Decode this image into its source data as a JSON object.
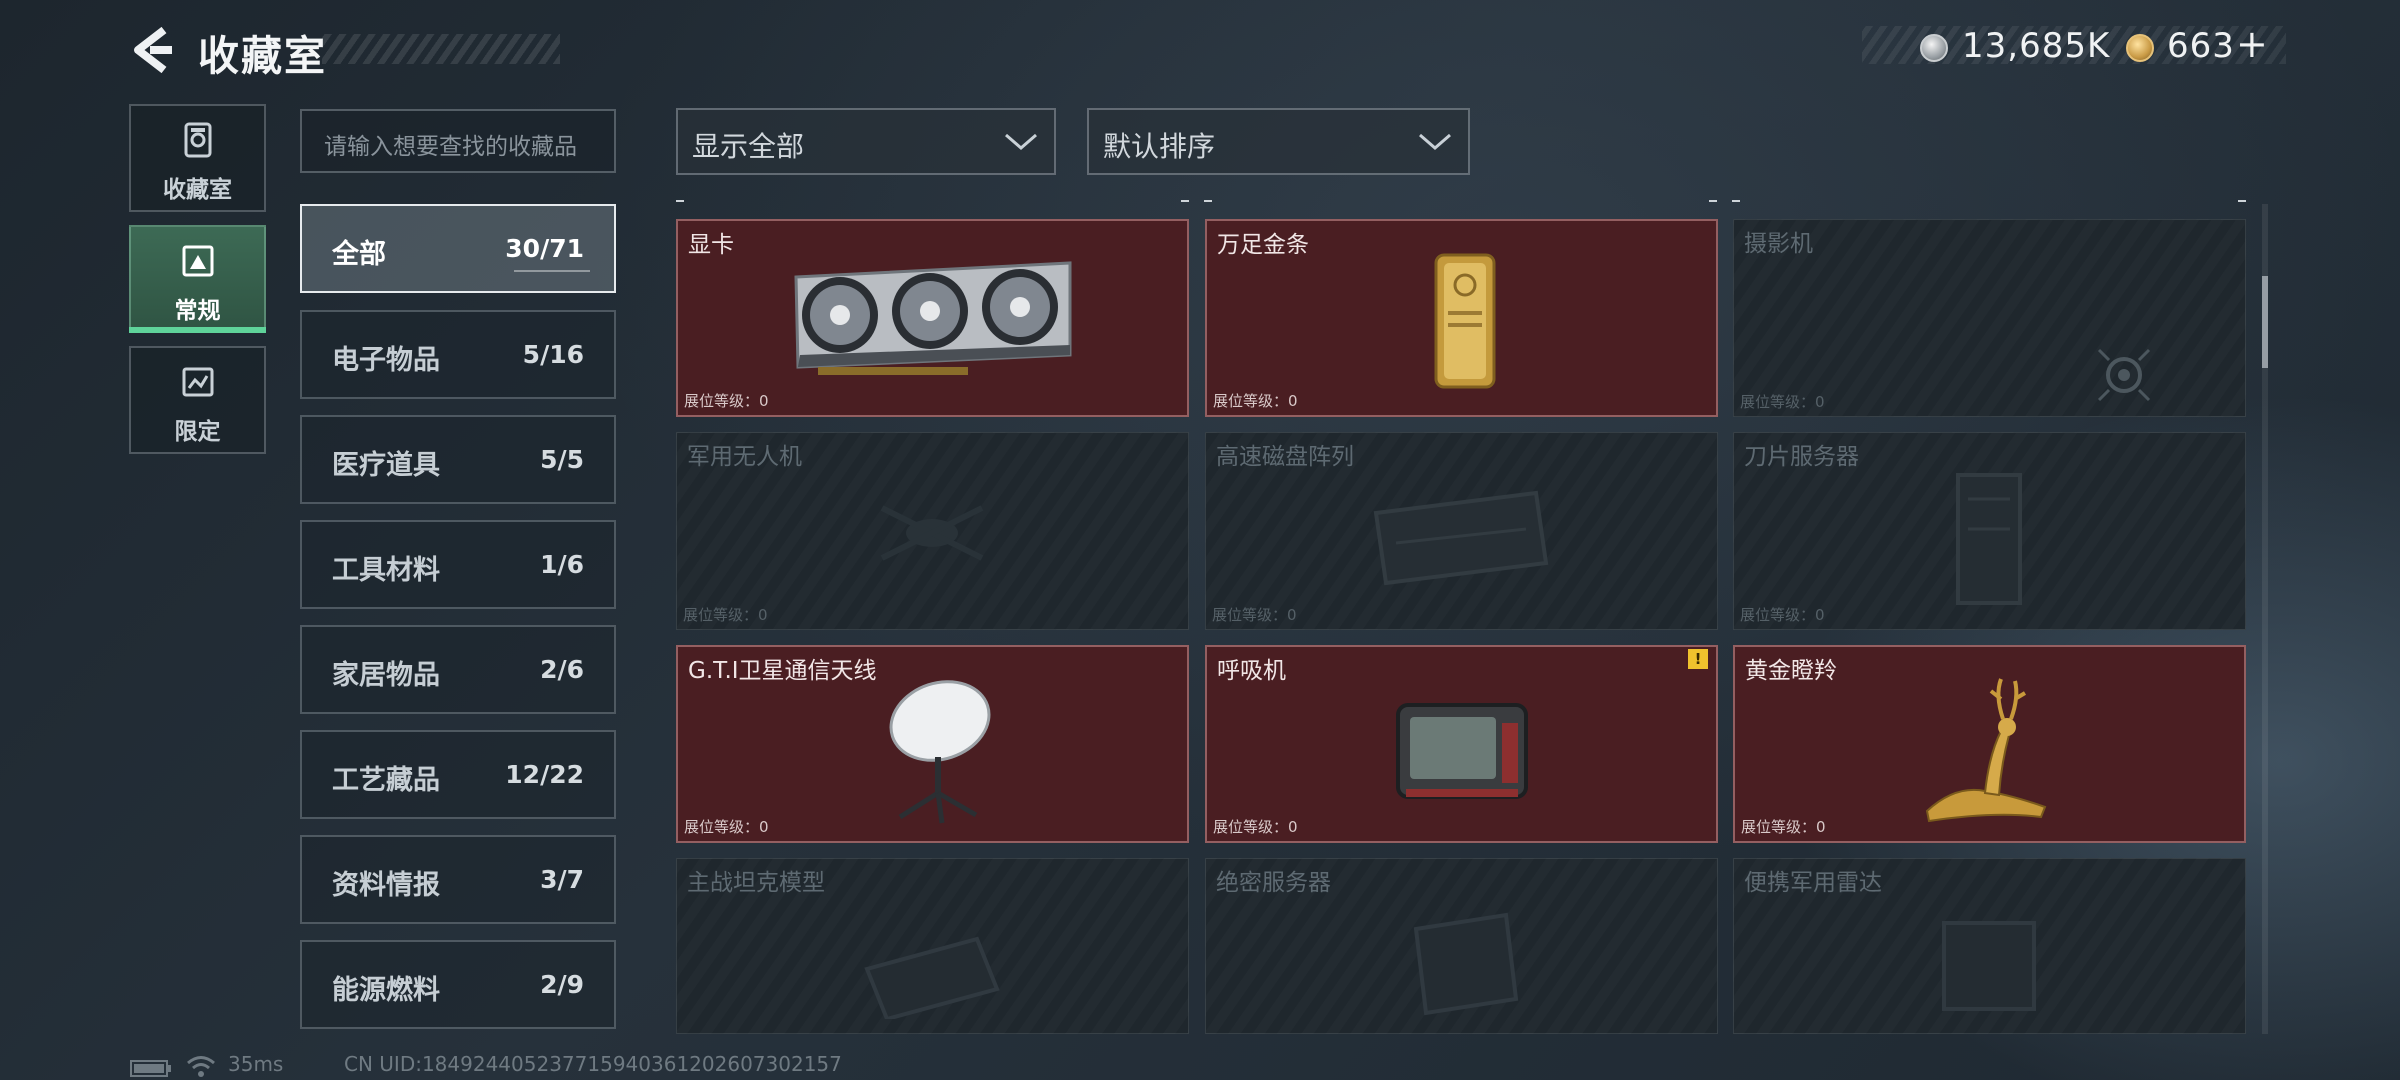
{
  "header": {
    "title": "收藏室",
    "silver": "13,685K",
    "gold": "663",
    "gold_plus": "+"
  },
  "colors": {
    "accent_green": "#5fd39a",
    "owned_card": "#4a1e22",
    "warning": "#f0c22d"
  },
  "nav": [
    {
      "label": "收藏室",
      "icon": "collection-room-icon"
    },
    {
      "label": "常规",
      "icon": "regular-icon",
      "active": true
    },
    {
      "label": "限定",
      "icon": "limited-icon"
    }
  ],
  "search": {
    "placeholder": "请输入想要查找的收藏品"
  },
  "categories": [
    {
      "name": "全部",
      "count": "30/71",
      "active": true
    },
    {
      "name": "电子物品",
      "count": "5/16"
    },
    {
      "name": "医疗道具",
      "count": "5/5"
    },
    {
      "name": "工具材料",
      "count": "1/6"
    },
    {
      "name": "家居物品",
      "count": "2/6"
    },
    {
      "name": "工艺藏品",
      "count": "12/22"
    },
    {
      "name": "资料情报",
      "count": "3/7"
    },
    {
      "name": "能源燃料",
      "count": "2/9"
    }
  ],
  "filters": {
    "display": "显示全部",
    "sort": "默认排序"
  },
  "items": [
    {
      "name": "显卡",
      "level": "展位等级：0",
      "owned": true,
      "icon": "gpu-icon"
    },
    {
      "name": "万足金条",
      "level": "展位等级：0",
      "owned": true,
      "icon": "gold-bar-icon"
    },
    {
      "name": "摄影机",
      "level": "展位等级：0",
      "owned": false,
      "icon": "camera-icon"
    },
    {
      "name": "军用无人机",
      "level": "展位等级：0",
      "owned": false,
      "icon": "drone-icon"
    },
    {
      "name": "高速磁盘阵列",
      "level": "展位等级：0",
      "owned": false,
      "icon": "disk-array-icon"
    },
    {
      "name": "刀片服务器",
      "level": "展位等级：0",
      "owned": false,
      "icon": "blade-server-icon"
    },
    {
      "name": "G.T.I卫星通信天线",
      "level": "展位等级：0",
      "owned": true,
      "icon": "satellite-dish-icon"
    },
    {
      "name": "呼吸机",
      "level": "展位等级：0",
      "owned": true,
      "icon": "ventilator-icon",
      "warning": "!"
    },
    {
      "name": "黄金瞪羚",
      "level": "展位等级：0",
      "owned": true,
      "icon": "gold-gazelle-icon"
    },
    {
      "name": "主战坦克模型",
      "level": "",
      "owned": false,
      "icon": "tank-model-icon"
    },
    {
      "name": "绝密服务器",
      "level": "",
      "owned": false,
      "icon": "secret-server-icon"
    },
    {
      "name": "便携军用雷达",
      "level": "",
      "owned": false,
      "icon": "portable-radar-icon"
    }
  ],
  "status": {
    "ping": "35ms",
    "uid": "CN UID:1849244052377159403612026073021​57"
  }
}
